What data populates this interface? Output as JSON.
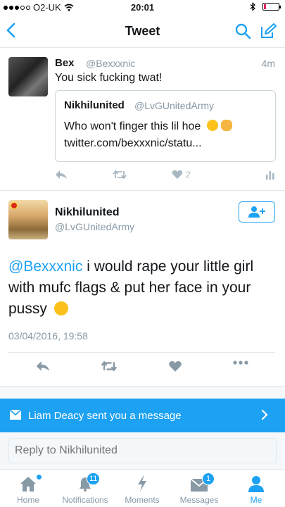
{
  "status_bar": {
    "carrier": "O2-UK",
    "time": "20:01"
  },
  "nav": {
    "title": "Tweet"
  },
  "reply_tweet": {
    "name": "Bex",
    "handle": "@Bexxxnic",
    "time": "4m",
    "text": "You sick fucking twat!",
    "quote": {
      "name": "Nikhilunited",
      "handle": "@LvGUnitedArmy",
      "line1": "Who won't finger this lil hoe",
      "line2": "twitter.com/bexxxnic/statu..."
    },
    "like_count": "2"
  },
  "main_tweet": {
    "name": "Nikhilunited",
    "handle": "@LvGUnitedArmy",
    "mention": "@Bexxxnic",
    "text": " i would rape your little girl with mufc flags & put her face in your pussy",
    "date": "03/04/2016, 19:58"
  },
  "dm_banner": {
    "text": "Liam Deacy sent you a message"
  },
  "reply_box": {
    "placeholder": "Reply to Nikhilunited"
  },
  "tabs": [
    {
      "label": "Home"
    },
    {
      "label": "Notifications",
      "badge": "11"
    },
    {
      "label": "Moments"
    },
    {
      "label": "Messages",
      "badge": "1"
    },
    {
      "label": "Me"
    }
  ],
  "colors": {
    "accent": "#1da1f2",
    "muted": "#8899a6",
    "action_grey": "#aab8c2"
  },
  "icons": [
    "back-chevron-icon",
    "search-icon",
    "compose-icon",
    "reply-icon",
    "retweet-icon",
    "heart-icon",
    "analytics-icon",
    "more-icon",
    "follow-icon",
    "envelope-icon",
    "chevron-right-icon",
    "home-icon",
    "bell-icon",
    "lightning-icon",
    "messages-icon",
    "person-icon"
  ]
}
